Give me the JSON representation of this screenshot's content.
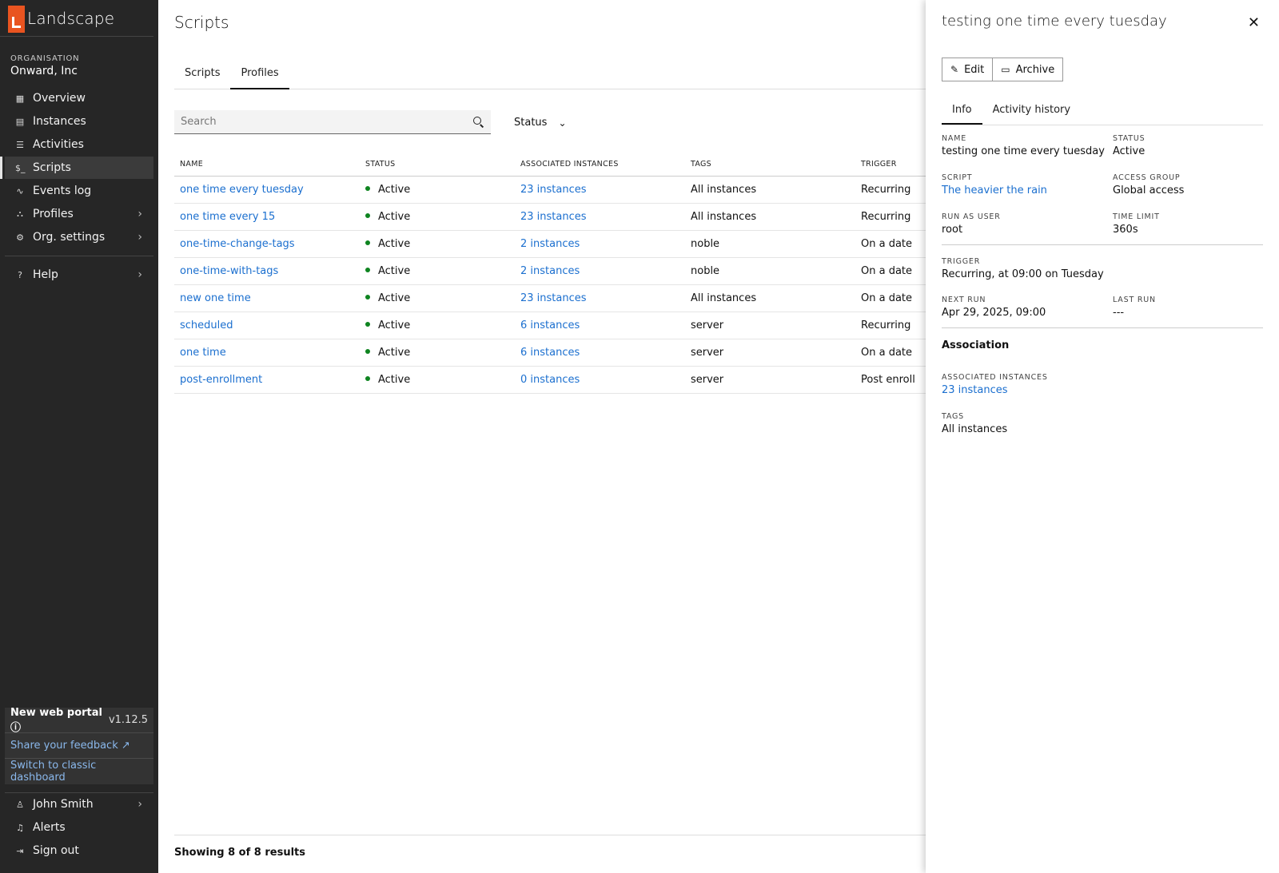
{
  "brand": "Landscape",
  "org": {
    "label": "ORGANISATION",
    "name": "Onward, Inc"
  },
  "nav": [
    {
      "label": "Overview",
      "icon": "overview-icon"
    },
    {
      "label": "Instances",
      "icon": "instances-icon"
    },
    {
      "label": "Activities",
      "icon": "activities-icon"
    },
    {
      "label": "Scripts",
      "icon": "scripts-icon",
      "active": true
    },
    {
      "label": "Events log",
      "icon": "events-icon"
    },
    {
      "label": "Profiles",
      "icon": "profiles-icon",
      "has_submenu": true
    },
    {
      "label": "Org. settings",
      "icon": "gear-icon",
      "has_submenu": true
    }
  ],
  "help": {
    "label": "Help"
  },
  "portal": {
    "title": "New web portal",
    "version": "v1.12.5",
    "feedback": "Share your feedback",
    "classic": "Switch to classic dashboard"
  },
  "bottom_nav": {
    "user": "John Smith",
    "alerts": "Alerts",
    "signout": "Sign out"
  },
  "main": {
    "title": "Scripts",
    "tabs": [
      {
        "label": "Scripts"
      },
      {
        "label": "Profiles",
        "active": true
      }
    ],
    "search_placeholder": "Search",
    "status_filter": "Status",
    "columns": [
      "NAME",
      "STATUS",
      "ASSOCIATED INSTANCES",
      "TAGS",
      "TRIGGER"
    ],
    "rows": [
      {
        "name": "one time every tuesday",
        "status": "Active",
        "instances": "23 instances",
        "tags": "All instances",
        "trigger": "Recurring"
      },
      {
        "name": "one time every 15",
        "status": "Active",
        "instances": "23 instances",
        "tags": "All instances",
        "trigger": "Recurring"
      },
      {
        "name": "one-time-change-tags",
        "status": "Active",
        "instances": "2 instances",
        "tags": "noble",
        "trigger": "On a date"
      },
      {
        "name": "one-time-with-tags",
        "status": "Active",
        "instances": "2 instances",
        "tags": "noble",
        "trigger": "On a date"
      },
      {
        "name": "new one time",
        "status": "Active",
        "instances": "23 instances",
        "tags": "All instances",
        "trigger": "On a date"
      },
      {
        "name": "scheduled",
        "status": "Active",
        "instances": "6 instances",
        "tags": "server",
        "trigger": "Recurring"
      },
      {
        "name": "one time",
        "status": "Active",
        "instances": "6 instances",
        "tags": "server",
        "trigger": "On a date"
      },
      {
        "name": "post-enrollment",
        "status": "Active",
        "instances": "0 instances",
        "tags": "server",
        "trigger": "Post enroll"
      }
    ],
    "results": "Showing 8 of 8 results"
  },
  "panel": {
    "title": "testing one time every tuesday",
    "edit": "Edit",
    "archive": "Archive",
    "tabs": [
      {
        "label": "Info",
        "active": true
      },
      {
        "label": "Activity history"
      }
    ],
    "name": {
      "label": "NAME",
      "value": "testing one time every tuesday"
    },
    "status": {
      "label": "STATUS",
      "value": "Active"
    },
    "script": {
      "label": "SCRIPT",
      "value": "The heavier the rain"
    },
    "access_group": {
      "label": "ACCESS GROUP",
      "value": "Global access"
    },
    "run_as": {
      "label": "RUN AS USER",
      "value": "root"
    },
    "time_limit": {
      "label": "TIME LIMIT",
      "value": "360s"
    },
    "trigger": {
      "label": "TRIGGER",
      "value": "Recurring, at 09:00 on Tuesday"
    },
    "next_run": {
      "label": "NEXT RUN",
      "value": "Apr 29, 2025, 09:00"
    },
    "last_run": {
      "label": "LAST RUN",
      "value": "---"
    },
    "association_heading": "Association",
    "assoc_instances": {
      "label": "ASSOCIATED INSTANCES",
      "value": "23 instances"
    },
    "tags": {
      "label": "TAGS",
      "value": "All instances"
    }
  },
  "colors": {
    "accent": "#e95420",
    "link": "#1b6fcf",
    "active_dot": "#0e8420",
    "sidebar_bg": "#262626"
  }
}
